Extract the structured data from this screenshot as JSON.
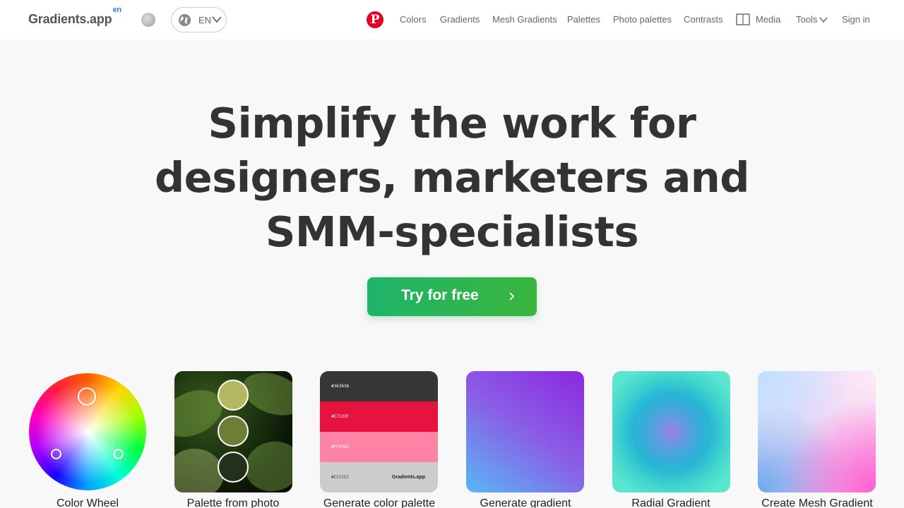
{
  "header": {
    "logo": "Gradients.app",
    "logo_sup": "en",
    "lang_code": "EN",
    "nav": {
      "colors": "Colors",
      "gradients": "Gradients",
      "mesh": "Mesh Gradients",
      "palettes": "Palettes",
      "photo_palettes": "Photo palettes",
      "contrasts": "Contrasts",
      "media": "Media",
      "tools": "Tools",
      "signin": "Sign in"
    },
    "icons": [
      "theme-toggle-icon",
      "globe-icon",
      "chevron-down-icon",
      "pinterest-icon",
      "media-book-icon"
    ]
  },
  "hero": {
    "line1": "Simplify the work for",
    "line2": "designers, marketers and",
    "line3": "SMM-specialists",
    "cta": "Try for free"
  },
  "tools": [
    {
      "label": "Color Wheel"
    },
    {
      "label": "Palette from photo",
      "swatches": [
        "#b5b860",
        "#6e7e36",
        "#25301a"
      ]
    },
    {
      "label": "Generate color palette",
      "rows": [
        {
          "hex": "#363636",
          "color": "#363636"
        },
        {
          "hex": "#E7133F",
          "color": "#e7133f"
        },
        {
          "hex": "#FF83A5",
          "color": "#ff83a5"
        },
        {
          "hex": "#CCCCCC",
          "color": "#cccccc"
        }
      ],
      "brand": "Gradients.app"
    },
    {
      "label": "Generate gradient"
    },
    {
      "label": "Radial Gradient"
    },
    {
      "label": "Create Mesh Gradient"
    }
  ],
  "colors": {
    "accent_green": "#22b35a",
    "pinterest": "#e60023",
    "logo_sup": "#3a7bd5"
  }
}
